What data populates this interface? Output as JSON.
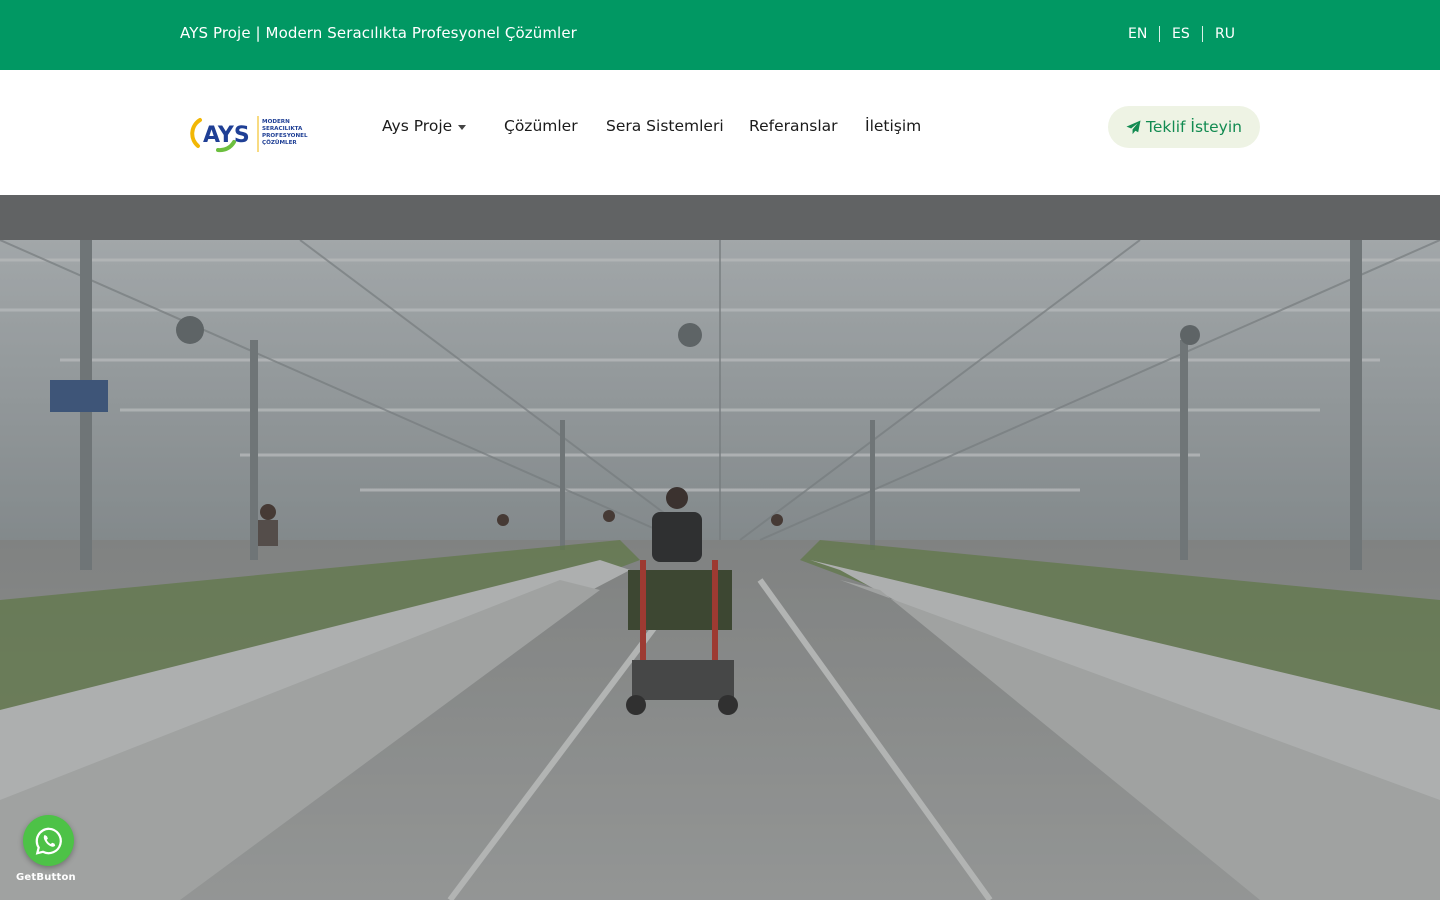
{
  "topbar": {
    "tagline": "AYS Proje | Modern Seracılıkta Profesyonel Çözümler",
    "languages": [
      "EN",
      "ES",
      "RU"
    ]
  },
  "logo": {
    "mark": "AYS",
    "lines": [
      "MODERN",
      "SERACILIKTA",
      "PROFESYONEL",
      "ÇÖZÜMLER"
    ]
  },
  "nav": {
    "items": [
      "Ays Proje",
      "Çözümler",
      "Sera Sistemleri",
      "Referanslar",
      "İletişim"
    ]
  },
  "cta": {
    "label": "Teklif İsteyin",
    "icon": "paper-plane-icon"
  },
  "hero": {
    "image": "greenhouse-video-still"
  },
  "widget": {
    "brand": "GetButton",
    "icon": "whatsapp-icon"
  },
  "colors": {
    "topbar": "#019863",
    "cta_bg": "#eef3e4",
    "cta_text": "#128b51",
    "whatsapp": "#4dc247"
  }
}
